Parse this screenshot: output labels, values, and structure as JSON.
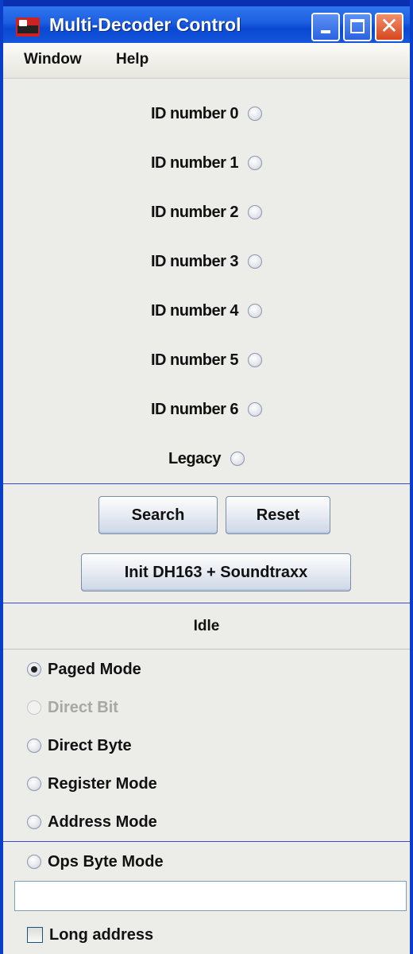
{
  "window": {
    "title": "Multi-Decoder Control"
  },
  "menu": [
    "Window",
    "Help"
  ],
  "decoders": [
    {
      "label": "ID number 0",
      "selected": false
    },
    {
      "label": "ID number 1",
      "selected": false
    },
    {
      "label": "ID number 2",
      "selected": false
    },
    {
      "label": "ID number 3",
      "selected": false
    },
    {
      "label": "ID number 4",
      "selected": false
    },
    {
      "label": "ID number 5",
      "selected": false
    },
    {
      "label": "ID number 6",
      "selected": false
    },
    {
      "label": "Legacy",
      "selected": false
    }
  ],
  "buttons": {
    "search": "Search",
    "reset": "Reset",
    "init": "Init DH163 + Soundtraxx"
  },
  "status": "Idle",
  "modes": [
    {
      "label": "Paged Mode",
      "selected": true,
      "enabled": true
    },
    {
      "label": "Direct Bit",
      "selected": false,
      "enabled": false
    },
    {
      "label": "Direct Byte",
      "selected": false,
      "enabled": true
    },
    {
      "label": "Register Mode",
      "selected": false,
      "enabled": true
    },
    {
      "label": "Address Mode",
      "selected": false,
      "enabled": true
    },
    {
      "label": "Ops Byte Mode",
      "selected": false,
      "enabled": true
    }
  ],
  "address_field": {
    "value": ""
  },
  "long_address": {
    "label": "Long address",
    "checked": false
  }
}
